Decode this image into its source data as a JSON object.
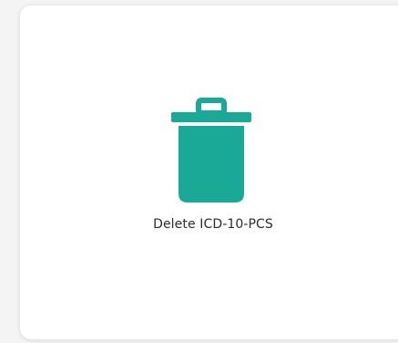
{
  "card": {
    "label": "Delete ICD-10-PCS",
    "icon": "trash-icon"
  },
  "colors": {
    "accent": "#1aa997",
    "background": "#f4f4f4",
    "card": "#ffffff",
    "text": "#2b2b2b"
  }
}
